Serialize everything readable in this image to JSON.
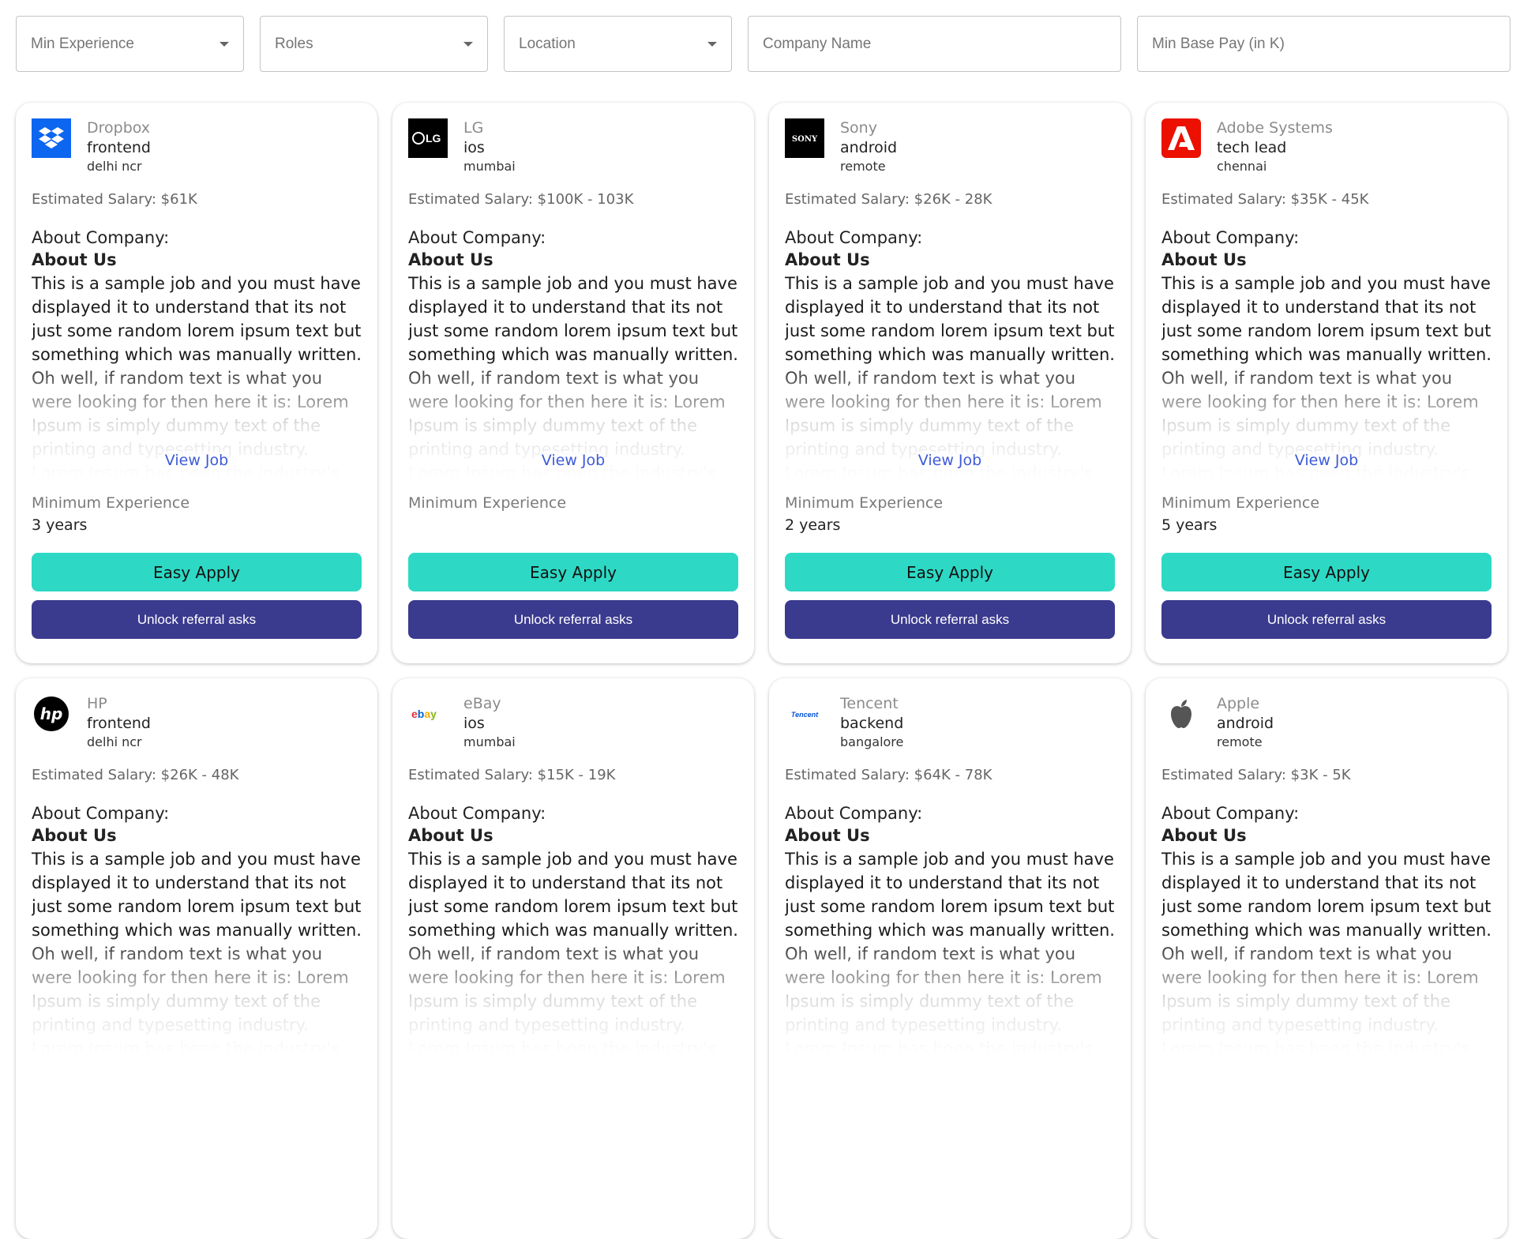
{
  "filters": {
    "min_experience": "Min Experience",
    "roles": "Roles",
    "location": "Location",
    "company_name": "Company Name",
    "min_base_pay": "Min Base Pay (in K)"
  },
  "labels": {
    "about_company": "About Company:",
    "about_us": "About Us",
    "view_job": "View Job",
    "minimum_experience": "Minimum Experience",
    "easy_apply": "Easy Apply",
    "unlock_referral": "Unlock referral asks",
    "description": "This is a sample job and you must have displayed it to understand that its not just some random lorem ipsum text but something which was manually written. Oh well, if random text is what you were looking for then here it is: Lorem Ipsum is simply dummy text of the printing and typesetting industry. Lorem Ipsum has been the industry's standard dummy text"
  },
  "jobs": [
    {
      "company": "Dropbox",
      "role": "frontend",
      "location": "delhi ncr",
      "salary": "Estimated Salary: $61K",
      "experience": "3 years",
      "logo_icon": "dropbox-logo-icon"
    },
    {
      "company": "LG",
      "role": "ios",
      "location": "mumbai",
      "salary": "Estimated Salary: $100K - 103K",
      "experience": "",
      "logo_icon": "lg-logo-icon"
    },
    {
      "company": "Sony",
      "role": "android",
      "location": "remote",
      "salary": "Estimated Salary: $26K - 28K",
      "experience": "2 years",
      "logo_icon": "sony-logo-icon"
    },
    {
      "company": "Adobe Systems",
      "role": "tech lead",
      "location": "chennai",
      "salary": "Estimated Salary: $35K - 45K",
      "experience": "5 years",
      "logo_icon": "adobe-logo-icon"
    },
    {
      "company": "HP",
      "role": "frontend",
      "location": "delhi ncr",
      "salary": "Estimated Salary: $26K - 48K",
      "experience": "",
      "logo_icon": "hp-logo-icon"
    },
    {
      "company": "eBay",
      "role": "ios",
      "location": "mumbai",
      "salary": "Estimated Salary: $15K - 19K",
      "experience": "",
      "logo_icon": "ebay-logo-icon"
    },
    {
      "company": "Tencent",
      "role": "backend",
      "location": "bangalore",
      "salary": "Estimated Salary: $64K - 78K",
      "experience": "",
      "logo_icon": "tencent-logo-icon"
    },
    {
      "company": "Apple",
      "role": "android",
      "location": "remote",
      "salary": "Estimated Salary: $3K - 5K",
      "experience": "",
      "logo_icon": "apple-logo-icon"
    }
  ],
  "colors": {
    "easy_apply_bg": "#2dd9c5",
    "referral_bg": "#3a3a8f",
    "link": "#3e5bd8"
  }
}
